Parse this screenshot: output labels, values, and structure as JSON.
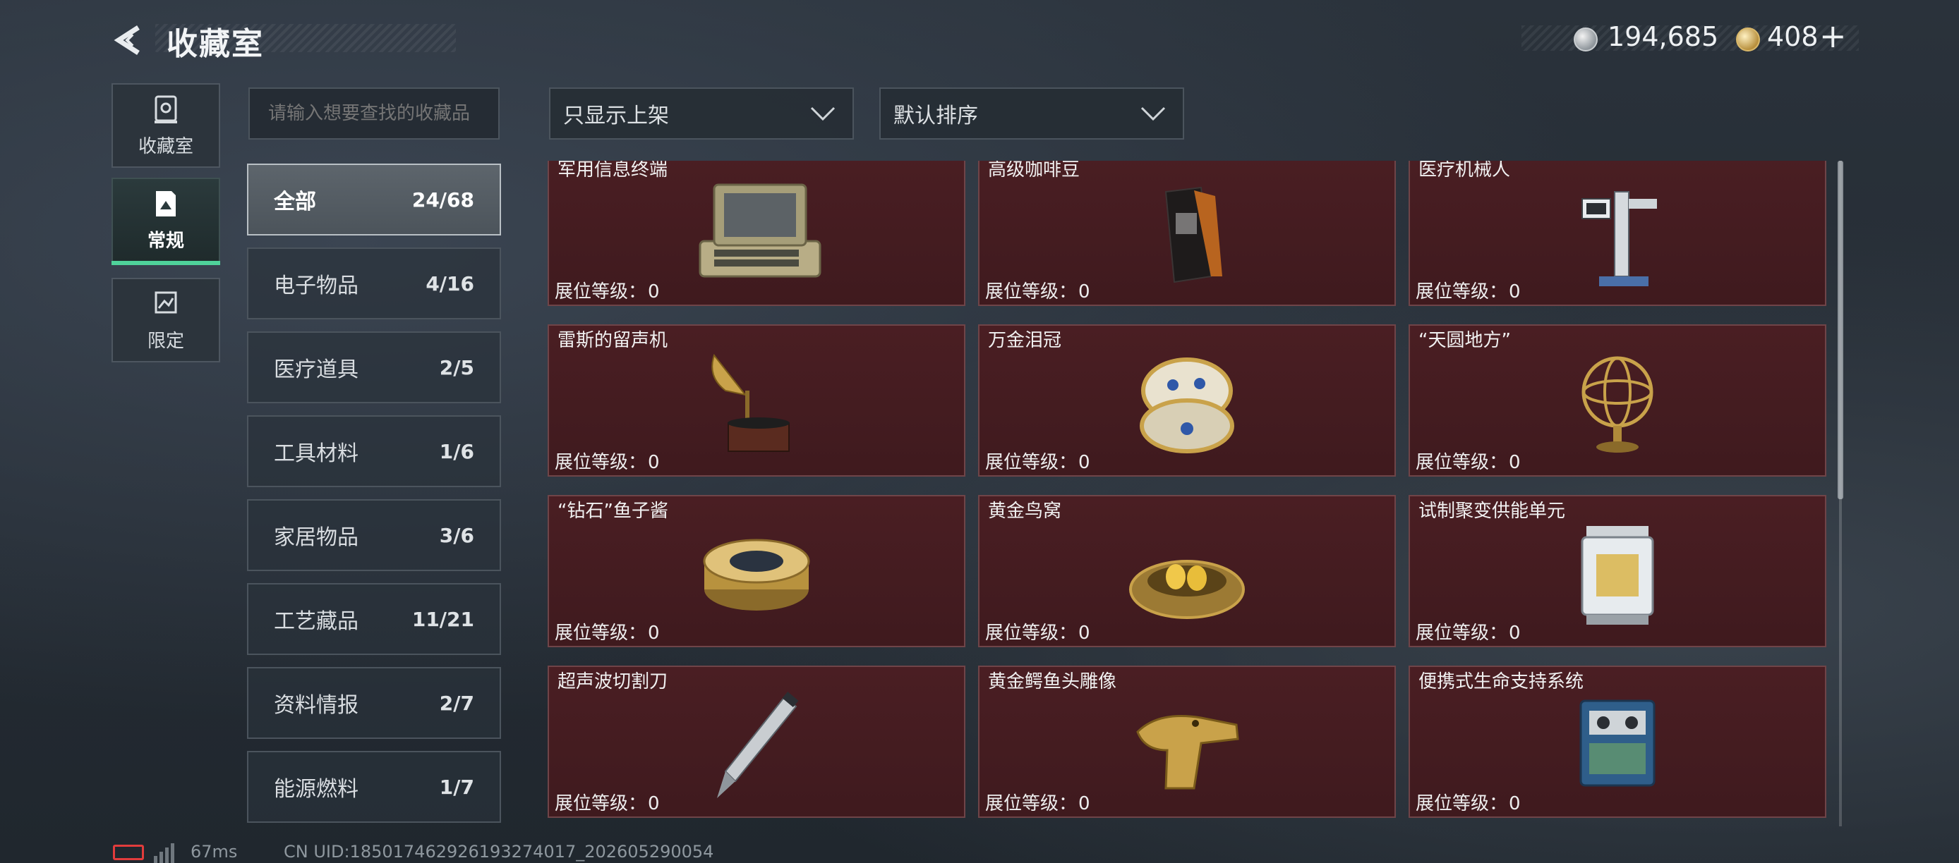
{
  "header": {
    "title": "收藏室",
    "currency_primary": "194,685",
    "currency_secondary": "408",
    "plus_label": "+"
  },
  "nav": [
    {
      "label": "收藏室",
      "icon": "vault-icon"
    },
    {
      "label": "常规",
      "icon": "regular-collection-icon",
      "active": true
    },
    {
      "label": "限定",
      "icon": "limited-collection-icon"
    }
  ],
  "search": {
    "placeholder": "请输入想要查找的收藏品"
  },
  "filters": {
    "display": "只显示上架",
    "sort": "默认排序"
  },
  "categories": [
    {
      "name": "全部",
      "count": "24/68",
      "active": true
    },
    {
      "name": "电子物品",
      "count": "4/16"
    },
    {
      "name": "医疗道具",
      "count": "2/5"
    },
    {
      "name": "工具材料",
      "count": "1/6"
    },
    {
      "name": "家居物品",
      "count": "3/6"
    },
    {
      "name": "工艺藏品",
      "count": "11/21"
    },
    {
      "name": "资料情报",
      "count": "2/7"
    },
    {
      "name": "能源燃料",
      "count": "1/7"
    }
  ],
  "level_label": "展位等级：",
  "items": [
    {
      "name": "军用信息终端",
      "level": "0",
      "icon": "military-terminal-icon"
    },
    {
      "name": "高级咖啡豆",
      "level": "0",
      "icon": "coffee-bag-icon"
    },
    {
      "name": "医疗机械人",
      "level": "0",
      "icon": "medical-robot-icon"
    },
    {
      "name": "雷斯的留声机",
      "level": "0",
      "icon": "gramophone-icon"
    },
    {
      "name": "万金泪冠",
      "level": "0",
      "icon": "jeweled-egg-icon"
    },
    {
      "name": "“天圆地方”",
      "level": "0",
      "icon": "armillary-sphere-icon"
    },
    {
      "name": "“钻石”鱼子酱",
      "level": "0",
      "icon": "caviar-tin-icon"
    },
    {
      "name": "黄金鸟窝",
      "level": "0",
      "icon": "golden-nest-icon"
    },
    {
      "name": "试制聚变供能单元",
      "level": "0",
      "icon": "fusion-cell-icon"
    },
    {
      "name": "超声波切割刀",
      "level": "0",
      "icon": "ultrasonic-knife-icon"
    },
    {
      "name": "黄金鳄鱼头雕像",
      "level": "0",
      "icon": "golden-crocodile-head-icon"
    },
    {
      "name": "便携式生命支持系统",
      "level": "0",
      "icon": "life-support-icon"
    }
  ],
  "footer": {
    "ping": "67ms",
    "uid": "CN UID:185017462926193274017_202605290054"
  },
  "colors": {
    "card_bg": "#4a1e23",
    "card_border": "#6f4448",
    "active_accent": "#4fd29a",
    "battery_low": "#e23c3c"
  }
}
